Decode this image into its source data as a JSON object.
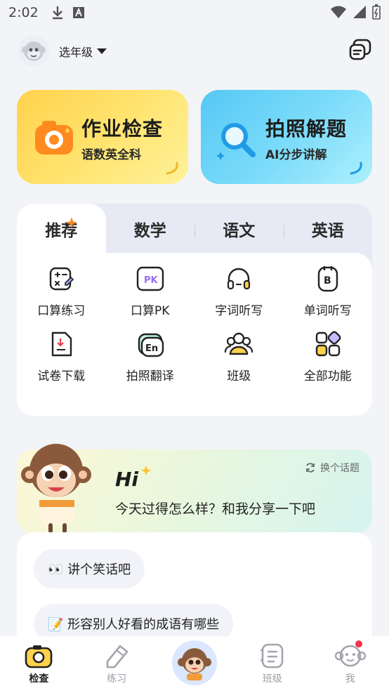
{
  "status": {
    "time": "2:02"
  },
  "header": {
    "grade_label": "选年级"
  },
  "cards": {
    "homework": {
      "title": "作业检查",
      "subtitle": "语数英全科"
    },
    "photo": {
      "title": "拍照解题",
      "subtitle": "AI分步讲解"
    }
  },
  "tabs": [
    "推荐",
    "数学",
    "语文",
    "英语"
  ],
  "features": [
    {
      "label": "口算练习",
      "icon": "math-practice-icon"
    },
    {
      "label": "口算PK",
      "icon": "pk-icon"
    },
    {
      "label": "字词听写",
      "icon": "headphones-icon"
    },
    {
      "label": "单词听写",
      "icon": "word-dictation-icon"
    },
    {
      "label": "试卷下载",
      "icon": "download-paper-icon"
    },
    {
      "label": "拍照翻译",
      "icon": "photo-translate-icon"
    },
    {
      "label": "班级",
      "icon": "class-group-icon"
    },
    {
      "label": "全部功能",
      "icon": "all-features-icon"
    }
  ],
  "chat": {
    "switch_label": "换个话题",
    "hi": "Hi",
    "greeting": "今天过得怎么样？和我分享一下吧",
    "suggestions": [
      "👀 讲个笑话吧",
      "📝 形容别人好看的成语有哪些"
    ]
  },
  "nav": [
    {
      "label": "检查",
      "active": true
    },
    {
      "label": "练习",
      "active": false
    },
    {
      "label": "",
      "active": false
    },
    {
      "label": "班级",
      "active": false
    },
    {
      "label": "我",
      "active": false
    }
  ],
  "colors": {
    "accent_yellow": "#ffd24d",
    "accent_blue": "#55c8f5",
    "badge_red": "#f2334a"
  }
}
